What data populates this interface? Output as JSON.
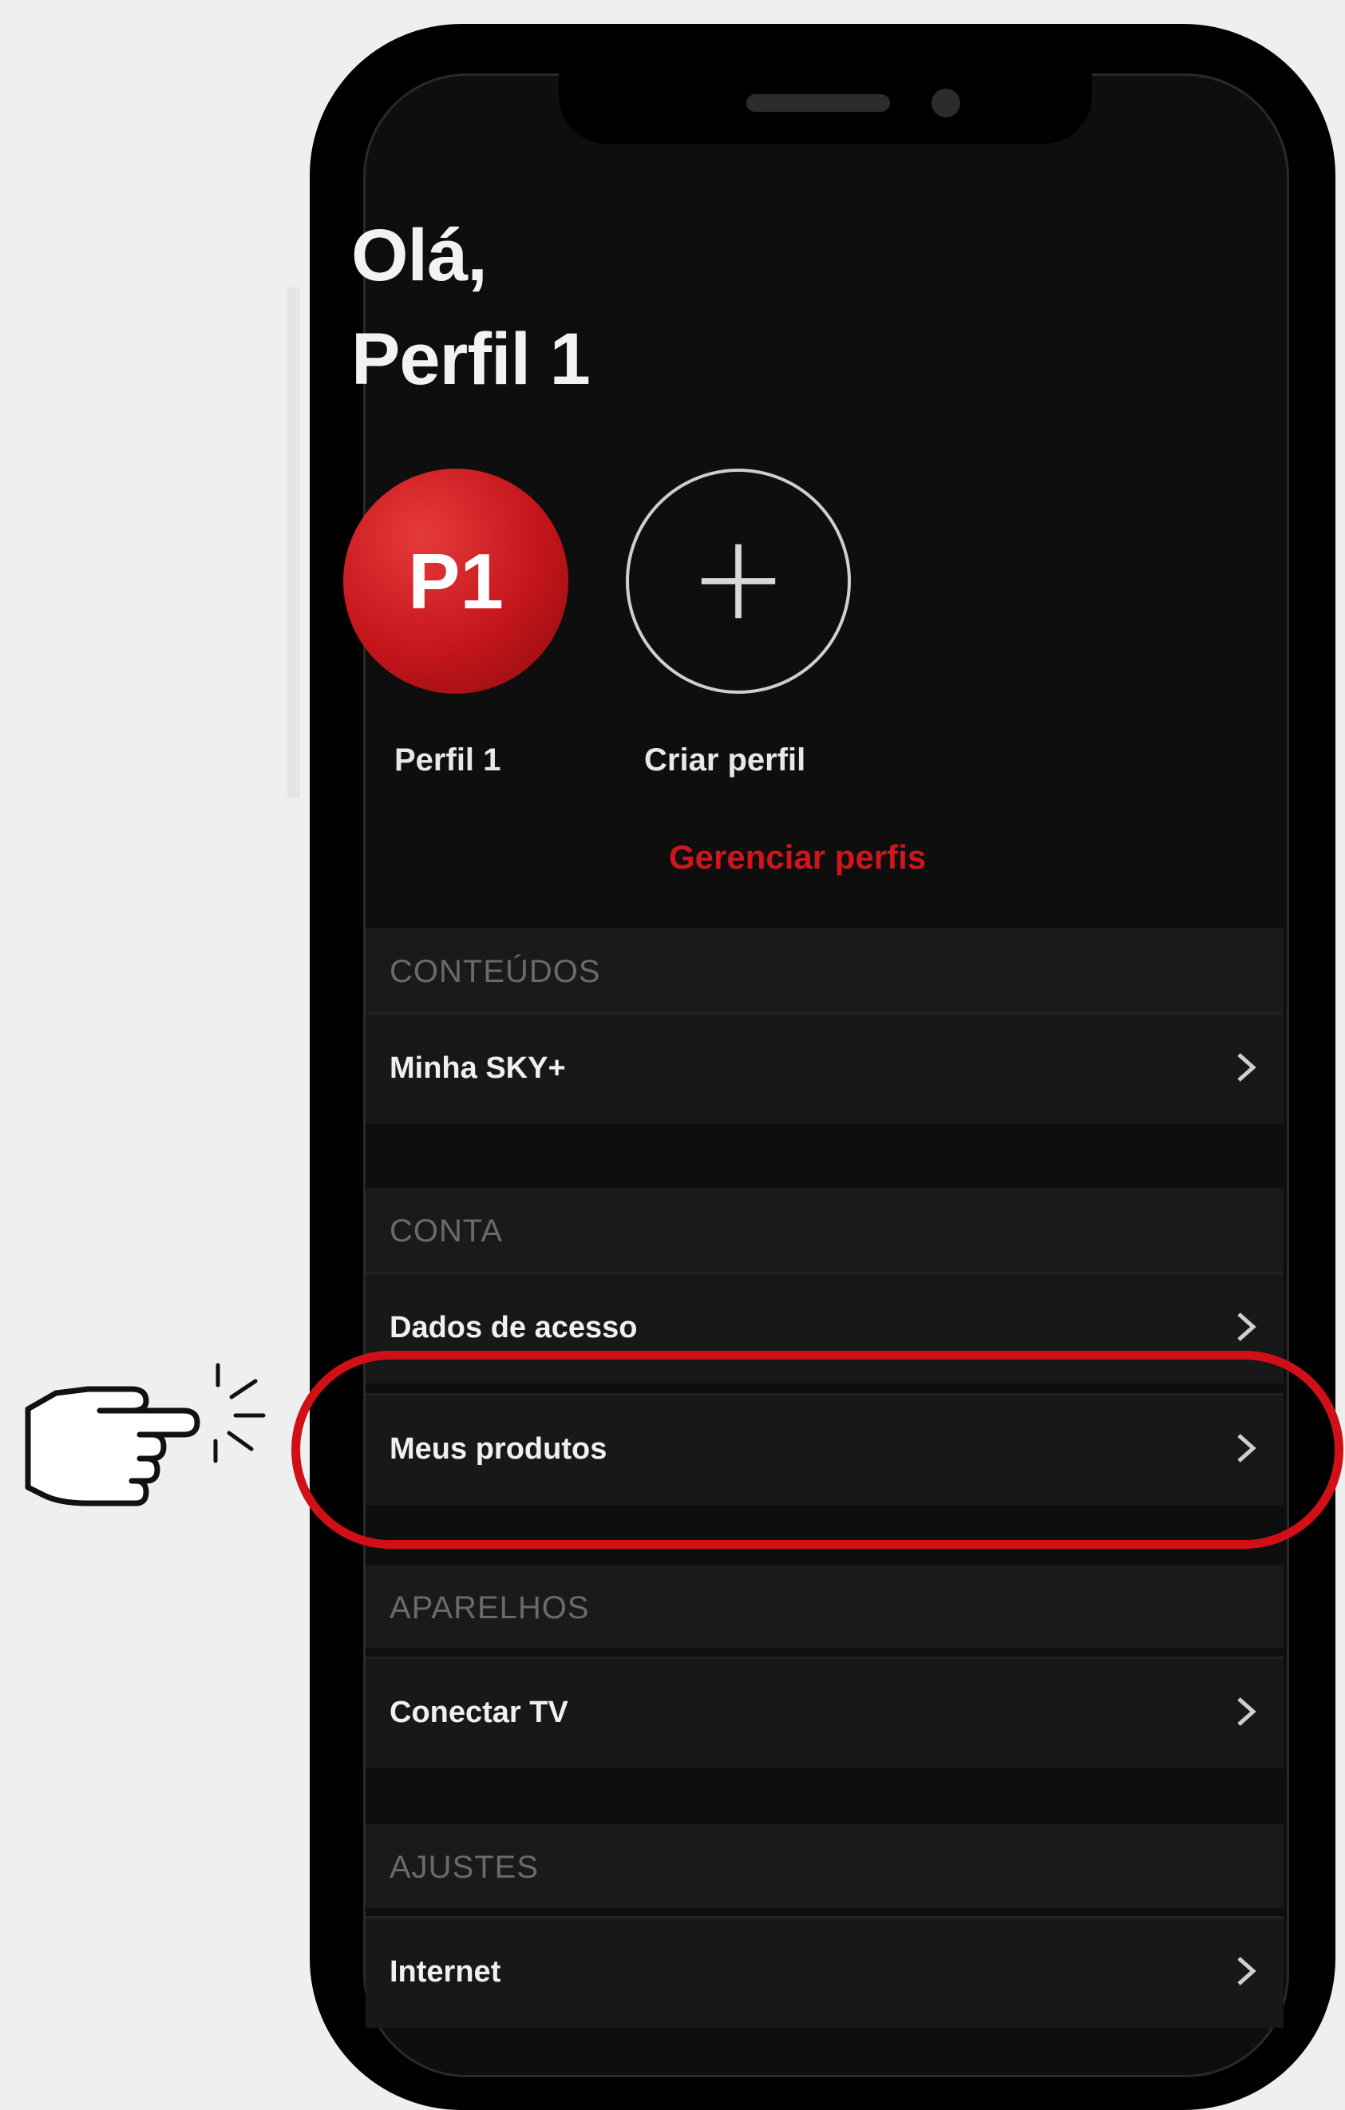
{
  "greeting": {
    "line1": "Olá,",
    "line2": "Perfil 1"
  },
  "profiles": [
    {
      "initials": "P1",
      "label": "Perfil 1",
      "color": "#c4151b"
    },
    {
      "initials": "+",
      "label": "Criar perfil"
    }
  ],
  "manage_profiles_label": "Gerenciar perfis",
  "sections": [
    {
      "header": "CONTEÚDOS",
      "items": [
        "Minha SKY+"
      ]
    },
    {
      "header": "CONTA",
      "items": [
        "Dados de acesso",
        "Meus produtos"
      ]
    },
    {
      "header": "APARELHOS",
      "items": [
        "Conectar TV"
      ]
    },
    {
      "header": "AJUSTES",
      "items": [
        "Internet"
      ]
    }
  ],
  "highlighted_item": "Meus produtos",
  "colors": {
    "accent": "#d10f17",
    "background": "#0e0e0e",
    "row": "#181818"
  },
  "icons": {
    "chevron": "chevron-right-icon",
    "add": "plus-icon",
    "pointer": "hand-pointer-icon"
  }
}
